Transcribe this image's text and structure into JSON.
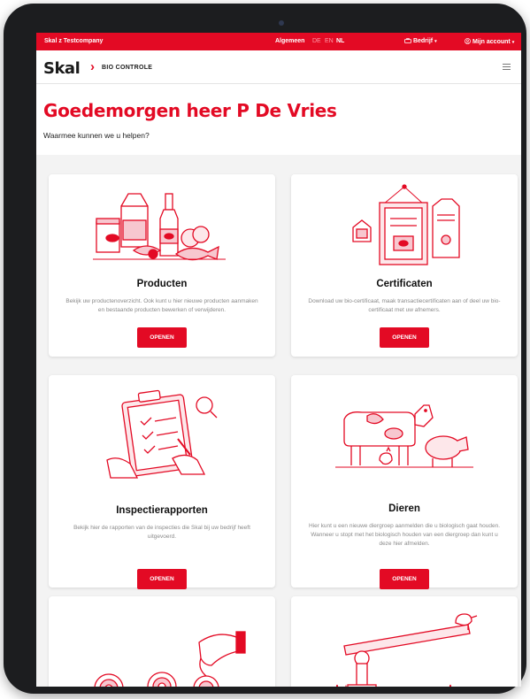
{
  "topbar": {
    "company": "Skal z Testcompany",
    "algemeen": "Algemeen",
    "languages": [
      "DE",
      "EN",
      "NL"
    ],
    "bedrijf": "Bedrijf",
    "account": "Mijn account"
  },
  "header": {
    "logo_text": "Skal",
    "logo_subtitle": "BIO CONTROLE"
  },
  "greeting": {
    "title": "Goedemorgen heer P De Vries",
    "subtitle": "Waarmee kunnen we u helpen?"
  },
  "cards": [
    {
      "title": "Producten",
      "description": "Bekijk uw productenoverzicht. Ook kunt u hier nieuwe producten aanmaken en bestaande producten bewerken of verwijderen.",
      "button": "OPENEN",
      "icon": "groceries-icon"
    },
    {
      "title": "Certificaten",
      "description": "Download uw bio-certificaat, maak transactiecertificaten aan of deel uw bio-certificaat met uw afnemers.",
      "button": "OPENEN",
      "icon": "certificates-icon"
    },
    {
      "title": "Inspectierapporten",
      "description": "Bekijk hier de rapporten van de inspecties die Skal bij uw bedrijf heeft uitgevoerd.",
      "button": "OPENEN",
      "icon": "clipboard-icon"
    },
    {
      "title": "Dieren",
      "description_lines": [
        "Hier kunt u een nieuwe diergroep aanmelden die u biologisch gaat houden.",
        "Wanneer u stopt met het biologisch houden van een diergroep dan kunt u deze hier afmelden."
      ],
      "button": "OPENEN",
      "icon": "farm-animals-icon"
    }
  ],
  "colors": {
    "brand_red": "#e30a24",
    "background": "#f3f3f3",
    "device_bezel": "#1c1d1f"
  }
}
